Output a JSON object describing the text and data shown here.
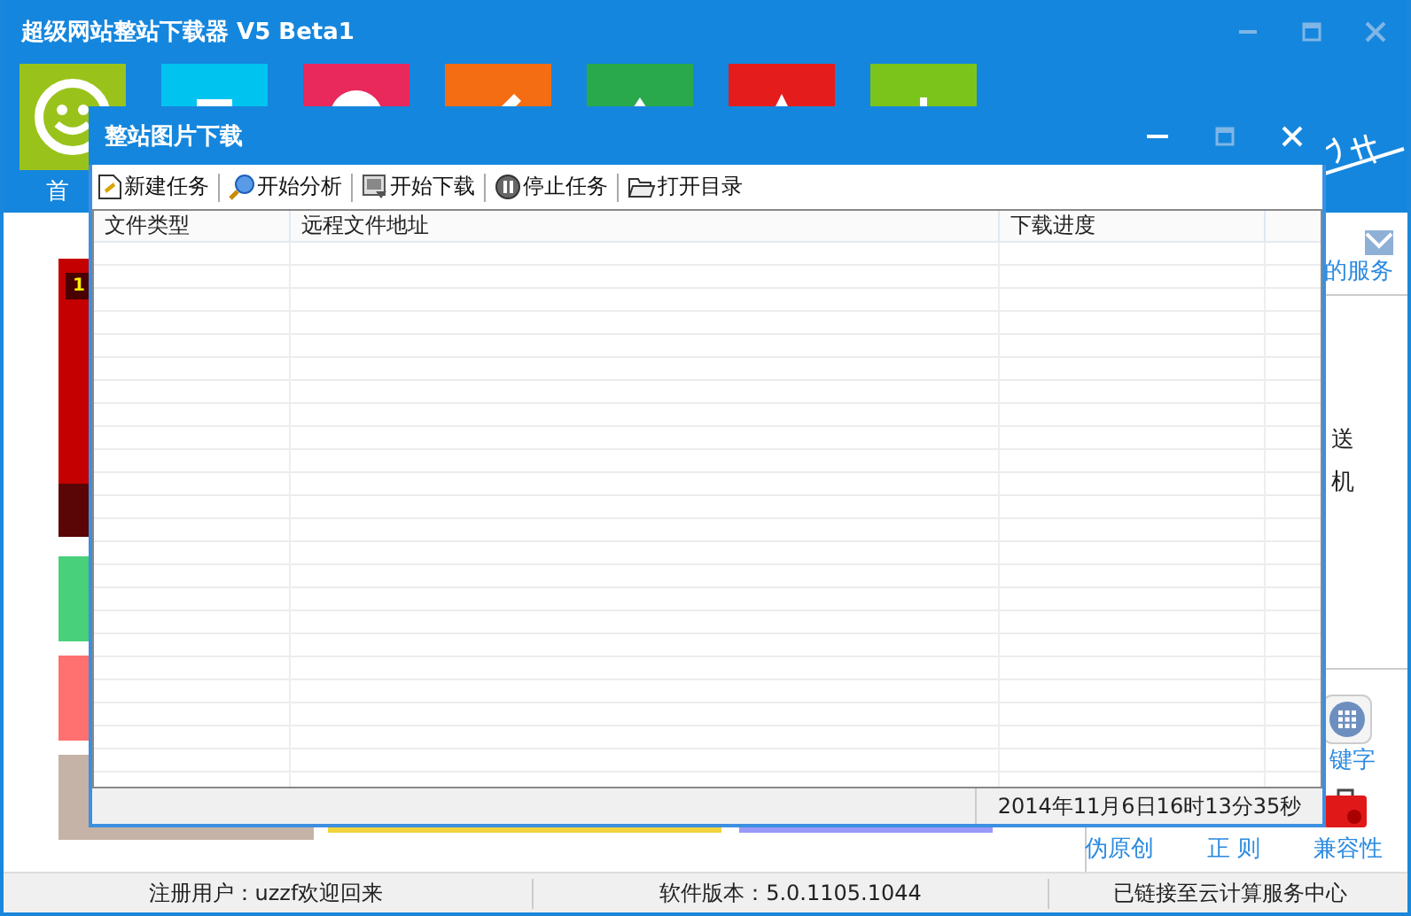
{
  "window": {
    "title": "超级网站整站下载器 V5 Beta1"
  },
  "tiles": [
    {
      "color": "#99c31a"
    },
    {
      "color": "#00c4ef"
    },
    {
      "color": "#e9285c"
    },
    {
      "color": "#f56d12"
    },
    {
      "color": "#29a94b"
    },
    {
      "color": "#e51c1c"
    },
    {
      "color": "#7bc41c"
    }
  ],
  "nav": [
    {
      "label": "首"
    }
  ],
  "banner": {
    "badge": "1"
  },
  "side_panel": {
    "service": "的服务",
    "line_1": "送",
    "line_2": "机",
    "keyword": "键字",
    "links": [
      "伪原创",
      "正 则",
      "兼容性"
    ]
  },
  "dialog": {
    "title": "整站图片下载",
    "toolbar": [
      "新建任务",
      "开始分析",
      "开始下载",
      "停止任务",
      "打开目录"
    ],
    "columns": [
      "文件类型",
      "远程文件地址",
      "下载进度"
    ],
    "status": "2014年11月6日16时13分35秒"
  },
  "status_bar": [
    "注册用户：uzzf欢迎回来",
    "软件版本：5.0.1105.1044",
    "已链接至云计算服务中心"
  ]
}
